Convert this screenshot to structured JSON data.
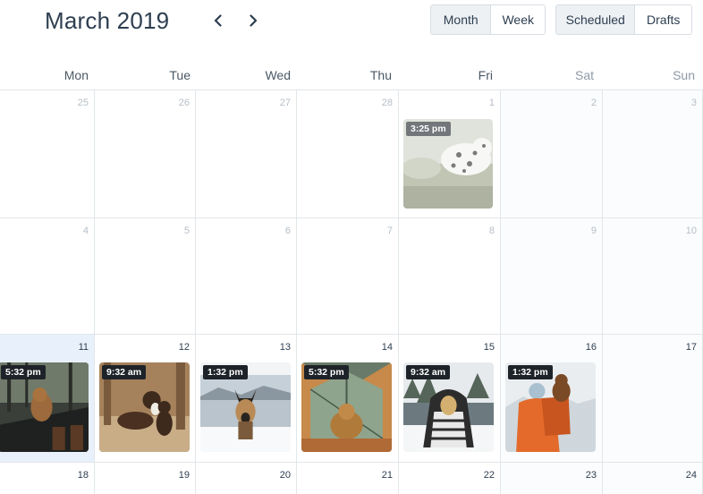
{
  "header": {
    "title": "March 2019"
  },
  "view_toggle": {
    "month": "Month",
    "week": "Week",
    "active": "month"
  },
  "status_toggle": {
    "scheduled": "Scheduled",
    "drafts": "Drafts",
    "active": "scheduled"
  },
  "weekdays": [
    "Mon",
    "Tue",
    "Wed",
    "Thu",
    "Fri",
    "Sat",
    "Sun"
  ],
  "weeks": [
    {
      "days": [
        "25",
        "26",
        "27",
        "28",
        "1",
        "2",
        "3"
      ]
    },
    {
      "days": [
        "4",
        "5",
        "6",
        "7",
        "8",
        "9",
        "10"
      ]
    },
    {
      "days": [
        "11",
        "12",
        "13",
        "14",
        "15",
        "16",
        "17"
      ]
    },
    {
      "days": [
        "18",
        "19",
        "20",
        "21",
        "22",
        "23",
        "24"
      ]
    }
  ],
  "posts": {
    "fri_1": {
      "time": "3:25 pm",
      "subject": "dalmatian-in-grass"
    },
    "mon_11": {
      "time": "5:32 pm",
      "subject": "dog-in-boat"
    },
    "tue_12": {
      "time": "9:32 am",
      "subject": "dogs-in-field"
    },
    "wed_13": {
      "time": "1:32 pm",
      "subject": "shepherd-by-lake"
    },
    "thu_14": {
      "time": "5:32 pm",
      "subject": "dog-in-tent"
    },
    "fri_15": {
      "time": "9:32 am",
      "subject": "dog-in-blanket-snow"
    },
    "sat_16": {
      "time": "1:32 pm",
      "subject": "dog-on-backpack"
    }
  },
  "colors": {
    "title": "#2d3e50",
    "grid_line": "#e1e6ea",
    "today_bg": "#e8f0fb",
    "badge_bg": "#1e2329",
    "active_toggle_bg": "#eef1f4"
  }
}
